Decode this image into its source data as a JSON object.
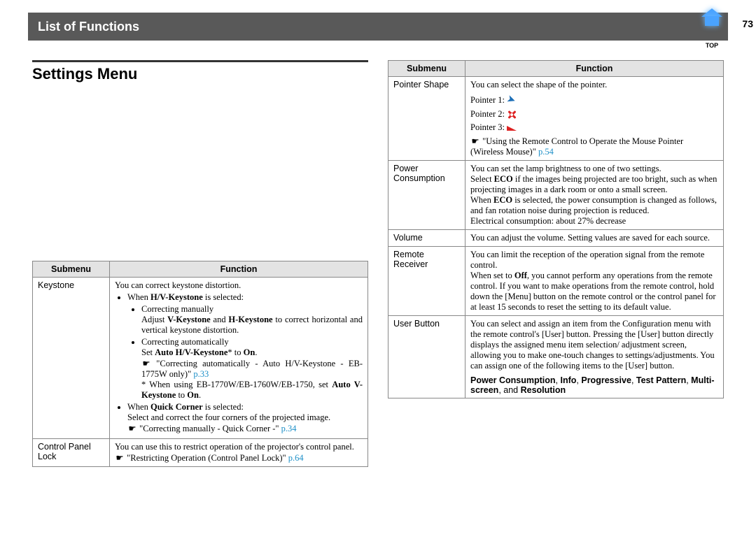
{
  "header": {
    "title": "List of Functions",
    "page_number": "73",
    "top_label": "TOP"
  },
  "section": {
    "title": "Settings Menu"
  },
  "table_headers": {
    "submenu": "Submenu",
    "function": "Function"
  },
  "left_table": {
    "keystone": {
      "name": "Keystone",
      "intro": "You can correct keystone distortion.",
      "b1a": "When ",
      "b1a_bold": "H/V-Keystone",
      "b1a_tail": " is selected:",
      "b2a": "Correcting manually",
      "b2a_detail_pre": "Adjust ",
      "b2a_bold1": "V-Keystone",
      "b2a_mid": " and ",
      "b2a_bold2": "H-Keystone",
      "b2a_detail_post": " to correct horizontal and vertical keystone distortion.",
      "b2b": "Correcting automatically",
      "b2b_detail_pre": "Set ",
      "b2b_bold": "Auto H/V-Keystone",
      "b2b_star": "*",
      "b2b_mid": " to ",
      "b2b_on": "On",
      "b2b_tail": ".",
      "b2b_ref_hand": "☛",
      "b2b_ref_text": " \"Correcting automatically - Auto H/V-Keystone - EB-1775W only)\" ",
      "b2b_ref_link": "p.33",
      "b2b_note_pre": "* When using EB-1770W/EB-1760W/EB-1750, set ",
      "b2b_note_bold": "Auto V-Keystone",
      "b2b_note_mid": " to ",
      "b2b_note_on": "On",
      "b2b_note_tail": ".",
      "b1b": "When ",
      "b1b_bold": "Quick Corner",
      "b1b_tail": " is selected:",
      "b1b_detail": "Select and correct the four corners of the projected image.",
      "b1b_ref_hand": "☛",
      "b1b_ref_text": " \"Correcting manually - Quick Corner -\" ",
      "b1b_ref_link": "p.34"
    },
    "cpl": {
      "name": "Control Panel Lock",
      "intro": "You can use this to restrict operation of the projector's control panel.",
      "ref_hand": "☛",
      "ref_text": " \"Restricting Operation (Control Panel Lock)\" ",
      "ref_link": "p.64"
    }
  },
  "right_table": {
    "pointer": {
      "name": "Pointer Shape",
      "intro": "You can select the shape of the pointer.",
      "p1": "Pointer 1:",
      "p2": "Pointer 2:",
      "p3": "Pointer 3:",
      "ref_hand": "☛",
      "ref_text": " \"Using the Remote Control to Operate the Mouse Pointer (Wireless Mouse)\" ",
      "ref_link": "p.54"
    },
    "power": {
      "name": "Power Consump­tion",
      "l1": "You can set the lamp brightness to one of two settings.",
      "l2_pre": "Select ",
      "l2_bold": "ECO",
      "l2_post": " if the images being projected are too bright, such as when projecting images in a dark room or onto a small screen.",
      "l3_pre": "When ",
      "l3_bold": "ECO",
      "l3_post": " is selected, the power consumption is changed as follows, and fan rotation noise during projection is reduced.",
      "l4": "Electrical consumption: about 27% decrease"
    },
    "volume": {
      "name": "Volume",
      "text": "You can adjust the volume. Setting values are saved for each source."
    },
    "remote": {
      "name": "Remote Receiver",
      "l1": "You can limit the reception of the operation signal from the remote control.",
      "l2_pre": "When set to ",
      "l2_bold": "Off",
      "l2_post": ", you cannot perform any operations from the remote control. If you want to make operations from the remote control, hold down the [Menu] button on the remote control or the control panel for at least 15 seconds to reset the setting to its default value."
    },
    "user": {
      "name": "User Button",
      "l1": "You can select and assign an item from the Configuration menu with the remote control's [User] button. Pressing the [User] button directly displays the assigned menu item selection/ adjustment screen, allowing you to make one-touch changes to settings/adjustments. You can assign one of the following items to the [User] button.",
      "l2_b1": "Power Consumption",
      "l2_s1": ", ",
      "l2_b2": "Info",
      "l2_s2": ", ",
      "l2_b3": "Progressive",
      "l2_s3": ", ",
      "l2_b4": "Test Pattern",
      "l2_s4": ", ",
      "l2_b5": "Multi-screen",
      "l2_s5": ", and ",
      "l2_b6": "Resolution"
    }
  }
}
